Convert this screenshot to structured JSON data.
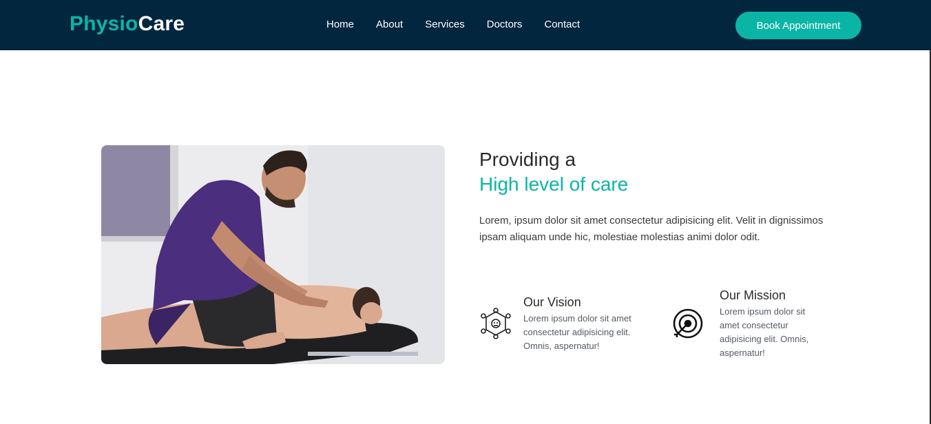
{
  "brand": {
    "part1": "Physio",
    "part2": "Care"
  },
  "nav": {
    "items": [
      "Home",
      "About",
      "Services",
      "Doctors",
      "Contact"
    ],
    "cta": "Book Appointment"
  },
  "colors": {
    "navbar": "#03263f",
    "accent": "#0bb5a6",
    "text": "#2b2b2b"
  },
  "hero": {
    "image_icon": "massage-therapy-photo",
    "title_line1": "Providing a",
    "title_line2": "High level of care",
    "paragraph": "Lorem, ipsum dolor sit amet consectetur adipisicing elit. Velit in dignissimos ipsam aliquam unde hic, molestiae molestias animi dolor odit."
  },
  "features": [
    {
      "icon": "vision-network-icon",
      "title": "Our Vision",
      "text": "Lorem ipsum dolor sit amet consectetur adipisicing elit. Omnis, aspernatur!"
    },
    {
      "icon": "target-icon",
      "title": "Our Mission",
      "text": "Lorem ipsum dolor sit amet consectetur adipisicing elit. Omnis, aspernatur!"
    }
  ]
}
